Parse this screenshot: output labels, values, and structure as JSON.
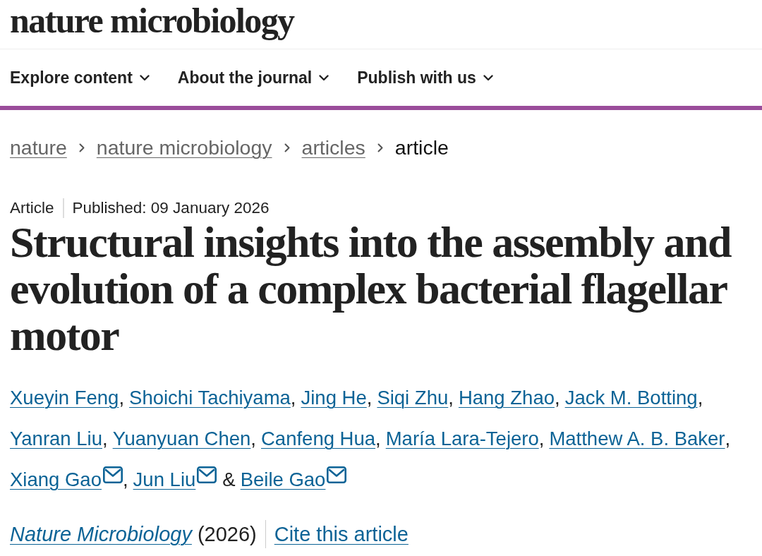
{
  "logo": {
    "text": "nature microbiology"
  },
  "nav": [
    {
      "label": "Explore content"
    },
    {
      "label": "About the journal"
    },
    {
      "label": "Publish with us"
    }
  ],
  "breadcrumb": [
    {
      "label": "nature",
      "kind": "link"
    },
    {
      "label": "nature microbiology",
      "kind": "link"
    },
    {
      "label": "articles",
      "kind": "link"
    },
    {
      "label": "article",
      "kind": "current"
    }
  ],
  "article": {
    "type": "Article",
    "published": "Published: 09 January 2026",
    "title": "Structural insights into the assembly and evolution of a complex bacterial flagellar motor",
    "authors": [
      {
        "name": "Xueyin Feng",
        "contact": false,
        "separator": ","
      },
      {
        "name": "Shoichi Tachiyama",
        "contact": false,
        "separator": ","
      },
      {
        "name": "Jing He",
        "contact": false,
        "separator": ","
      },
      {
        "name": "Siqi Zhu",
        "contact": false,
        "separator": ","
      },
      {
        "name": "Hang Zhao",
        "contact": false,
        "separator": ","
      },
      {
        "name": "Jack M. Botting",
        "contact": false,
        "separator": ","
      },
      {
        "name": "Yanran Liu",
        "contact": false,
        "separator": ","
      },
      {
        "name": "Yuanyuan Chen",
        "contact": false,
        "separator": ","
      },
      {
        "name": "Canfeng Hua",
        "contact": false,
        "separator": ","
      },
      {
        "name": "María Lara-Tejero",
        "contact": false,
        "separator": ","
      },
      {
        "name": "Matthew A. B. Baker",
        "contact": false,
        "separator": ","
      },
      {
        "name": "Xiang Gao",
        "contact": true,
        "separator": ","
      },
      {
        "name": "Jun Liu",
        "contact": true,
        "separator": "&"
      },
      {
        "name": "Beile Gao",
        "contact": true
      }
    ],
    "citation": {
      "journal": "Nature Microbiology",
      "year": "(2026)",
      "cite_link": "Cite this article"
    }
  }
}
